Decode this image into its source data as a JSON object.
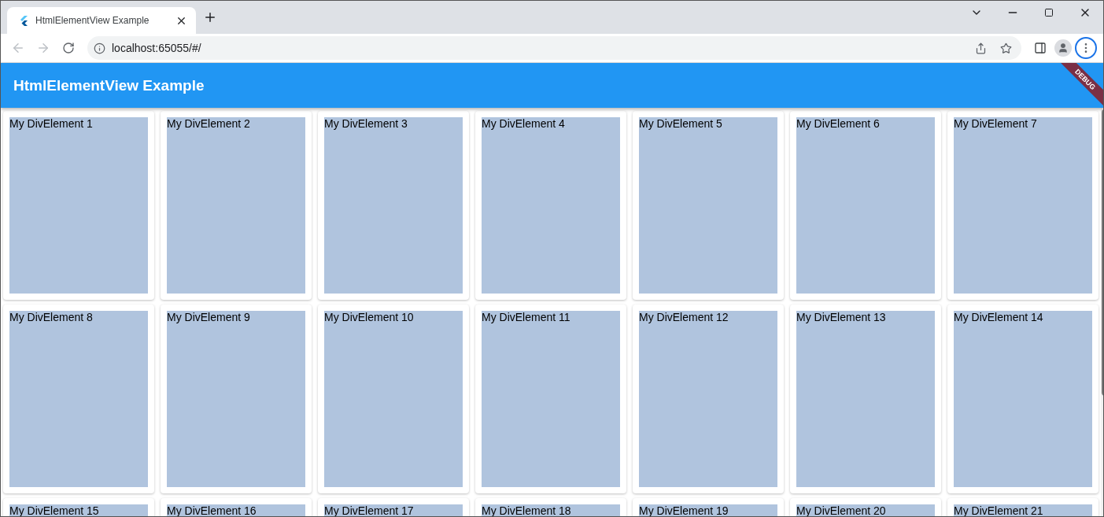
{
  "browser": {
    "tab": {
      "title": "HtmlElementView Example"
    },
    "address": "localhost:65055/#/"
  },
  "app_bar": {
    "title": "HtmlElementView Example"
  },
  "debug_banner": "DEBUG",
  "grid": {
    "items": [
      "My DivElement 1",
      "My DivElement 2",
      "My DivElement 3",
      "My DivElement 4",
      "My DivElement 5",
      "My DivElement 6",
      "My DivElement 7",
      "My DivElement 8",
      "My DivElement 9",
      "My DivElement 10",
      "My DivElement 11",
      "My DivElement 12",
      "My DivElement 13",
      "My DivElement 14",
      "My DivElement 15",
      "My DivElement 16",
      "My DivElement 17",
      "My DivElement 18",
      "My DivElement 19",
      "My DivElement 20",
      "My DivElement 21"
    ]
  }
}
